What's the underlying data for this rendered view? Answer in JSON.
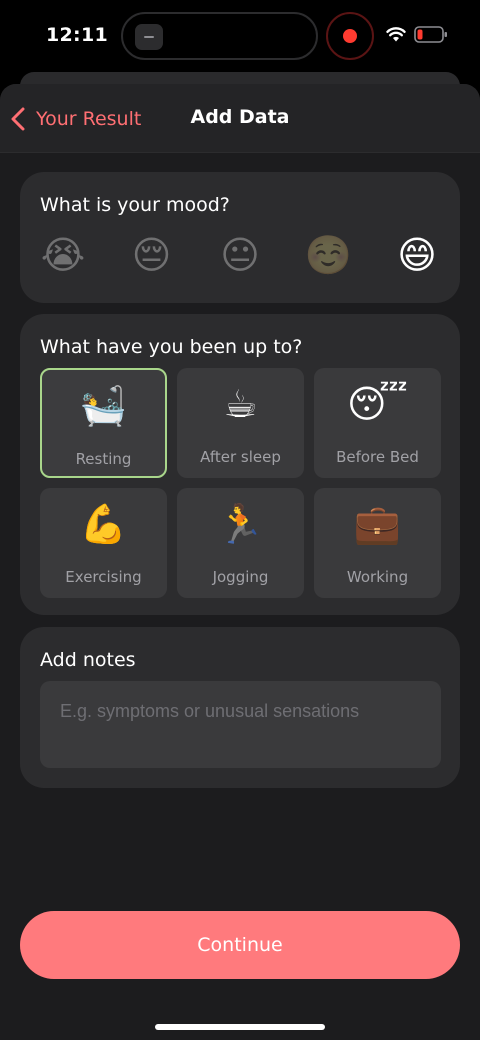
{
  "status_bar": {
    "time": "12:11"
  },
  "nav": {
    "back_label": "Your Result",
    "title": "Add Data"
  },
  "mood": {
    "question": "What is your mood?",
    "options": [
      {
        "icon": "😭",
        "name": "crying"
      },
      {
        "icon": "😔",
        "name": "sad"
      },
      {
        "icon": "😐",
        "name": "neutral"
      },
      {
        "icon": "☺️",
        "name": "content"
      },
      {
        "icon": "😄",
        "name": "happy",
        "selected": true
      }
    ]
  },
  "activity": {
    "question": "What have you been up to?",
    "options": [
      {
        "icon": "🛀",
        "label": "Resting",
        "selected": true
      },
      {
        "icon": "☕",
        "label": "After sleep"
      },
      {
        "icon": "😴",
        "label": "Before Bed"
      },
      {
        "icon": "💪",
        "label": "Exercising"
      },
      {
        "icon": "🏃",
        "label": "Jogging"
      },
      {
        "icon": "💼",
        "label": "Working"
      }
    ]
  },
  "notes": {
    "title": "Add notes",
    "placeholder": "E.g. symptoms or unusual sensations",
    "value": ""
  },
  "continue_label": "Continue",
  "colors": {
    "accent": "#ff6f73",
    "button": "#ff7a7d",
    "selected_border": "#a9d68b",
    "card": "#2c2c2e"
  }
}
